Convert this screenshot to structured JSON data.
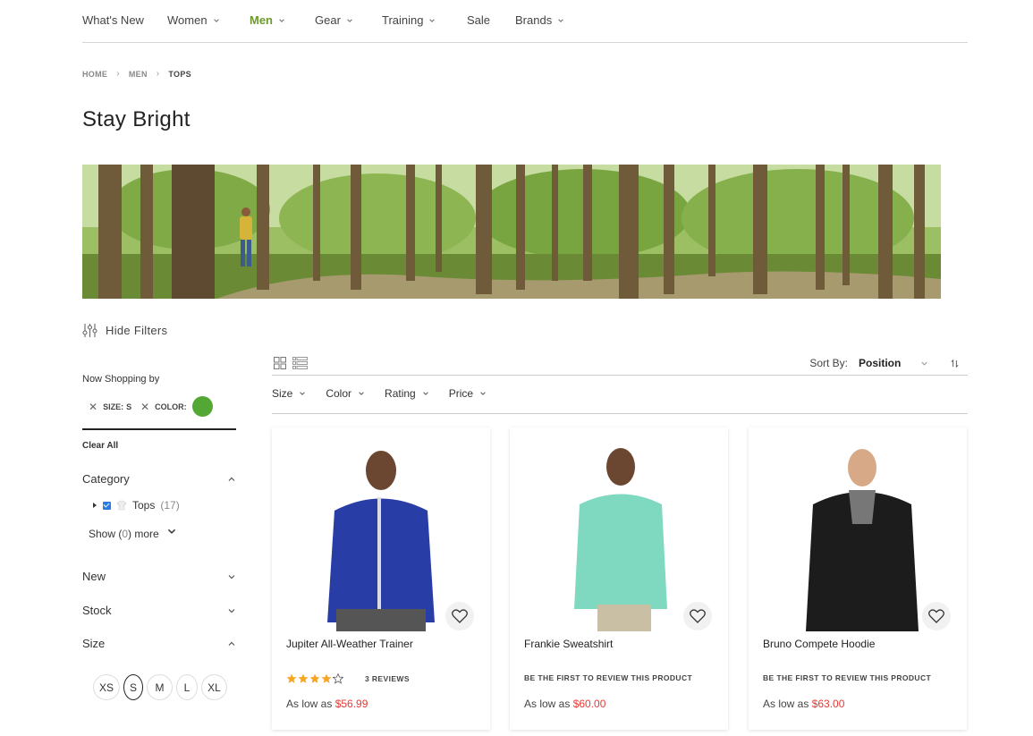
{
  "nav": {
    "items": [
      {
        "label": "What's New",
        "has_menu": false
      },
      {
        "label": "Women",
        "has_menu": true
      },
      {
        "label": "Men",
        "has_menu": true,
        "active": true
      },
      {
        "label": "Gear",
        "has_menu": true
      },
      {
        "label": "Training",
        "has_menu": true
      },
      {
        "label": "Sale",
        "has_menu": false
      },
      {
        "label": "Brands",
        "has_menu": true
      }
    ]
  },
  "breadcrumb": {
    "items": [
      "HOME",
      "MEN",
      "TOPS"
    ]
  },
  "page_title": "Stay Bright",
  "filters_toggle": {
    "label": "Hide Filters",
    "icon": "sliders-icon"
  },
  "sidebar": {
    "now_shopping_label": "Now Shopping by",
    "active_filters": [
      {
        "label": "SIZE:",
        "value": "S"
      },
      {
        "label": "COLOR:",
        "swatch_color": "#53a835"
      }
    ],
    "clear_all": "Clear All",
    "category": {
      "title": "Category",
      "item_label": "Tops",
      "item_count": "(17)",
      "show_more_prefix": "Show (",
      "show_more_count": "0",
      "show_more_suffix": ") more"
    },
    "new_title": "New",
    "stock_title": "Stock",
    "size_title": "Size",
    "sizes": [
      "XS",
      "S",
      "M",
      "L",
      "XL"
    ],
    "selected_size": "S"
  },
  "toolbar": {
    "sort_label": "Sort By:",
    "sort_value": "Position"
  },
  "filter_bar": [
    "Size",
    "Color",
    "Rating",
    "Price"
  ],
  "products": [
    {
      "name": "Jupiter All-Weather Trainer",
      "rating": 4,
      "rating_max": 5,
      "reviews": "3 REVIEWS",
      "price_prefix": "As low as",
      "price": "$56.99",
      "color": "#283ea6"
    },
    {
      "name": "Frankie Sweatshirt",
      "reviews": "BE THE FIRST TO REVIEW THIS PRODUCT",
      "price_prefix": "As low as",
      "price": "$60.00",
      "color": "#7fd8c0"
    },
    {
      "name": "Bruno Compete Hoodie",
      "reviews": "BE THE FIRST TO REVIEW THIS PRODUCT",
      "price_prefix": "As low as",
      "price": "$63.00",
      "color": "#1c1c1c"
    }
  ],
  "colors": {
    "accent_green": "#6c9a2b",
    "price_red": "#e53935",
    "checkbox_blue": "#2a7ae2"
  }
}
